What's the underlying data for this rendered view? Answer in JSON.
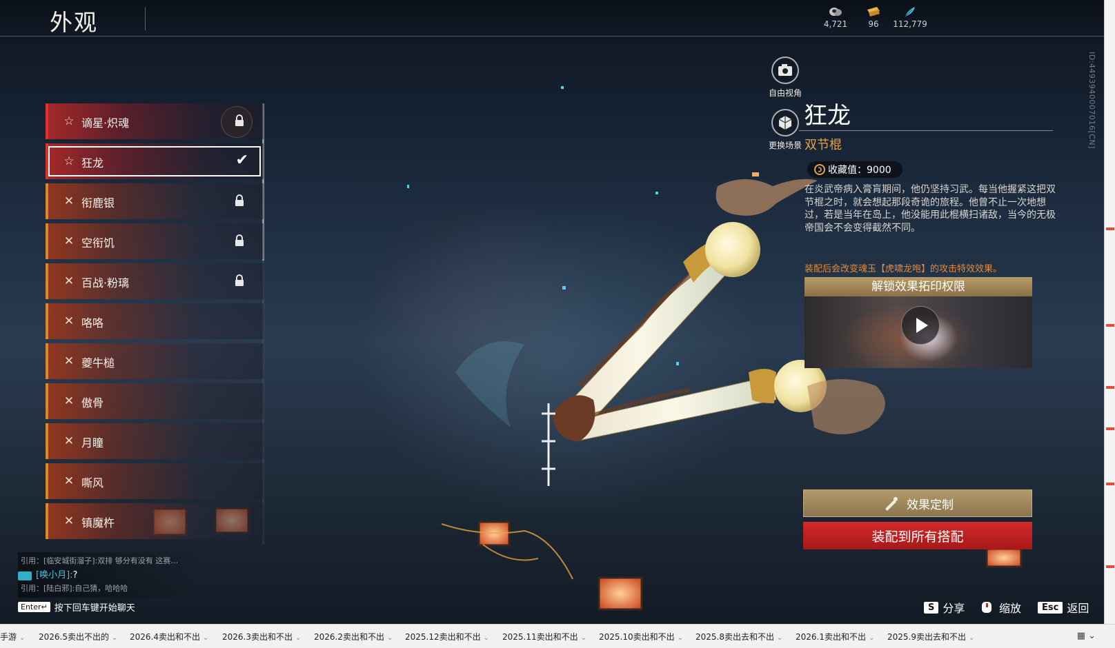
{
  "header": {
    "title": "外观",
    "currencies": [
      {
        "icon": "coin-stack-icon",
        "value": "4,721",
        "color": "#c8c8c8"
      },
      {
        "icon": "gold-ticket-icon",
        "value": "96",
        "color": "#e8b64a"
      },
      {
        "icon": "feather-icon",
        "value": "112,779",
        "color": "#3ec0d8"
      }
    ]
  },
  "side_id": "ID:4493940007016[CN]",
  "camera": {
    "free_view_label": "自由视角",
    "change_scene_label": "更换场景"
  },
  "items": [
    {
      "label": "谪星·炽魂",
      "icon": "star-icon",
      "rarity_color": "#e0322d",
      "locked": true,
      "selected": false
    },
    {
      "label": "狂龙",
      "icon": "star-icon",
      "rarity_color": "#e0322d",
      "locked": false,
      "selected": true
    },
    {
      "label": "衔鹿银",
      "icon": "cross-icon",
      "rarity_color": "#d9892b",
      "locked": true,
      "selected": false
    },
    {
      "label": "空衔饥",
      "icon": "cross-icon",
      "rarity_color": "#d9892b",
      "locked": true,
      "selected": false
    },
    {
      "label": "百战·粉璃",
      "icon": "cross-icon",
      "rarity_color": "#d9892b",
      "locked": true,
      "selected": false
    },
    {
      "label": "咯咯",
      "icon": "cross-icon",
      "rarity_color": "#d9892b",
      "locked": false,
      "selected": false
    },
    {
      "label": "夔牛槌",
      "icon": "cross-icon",
      "rarity_color": "#d9892b",
      "locked": false,
      "selected": false
    },
    {
      "label": "傲骨",
      "icon": "cross-icon",
      "rarity_color": "#d9892b",
      "locked": false,
      "selected": false
    },
    {
      "label": "月瞳",
      "icon": "cross-icon",
      "rarity_color": "#d9892b",
      "locked": false,
      "selected": false
    },
    {
      "label": "嘶风",
      "icon": "cross-icon",
      "rarity_color": "#d9892b",
      "locked": false,
      "selected": false
    },
    {
      "label": "镇魔杵",
      "icon": "cross-icon",
      "rarity_color": "#d9892b",
      "locked": false,
      "selected": false
    }
  ],
  "details": {
    "name": "狂龙",
    "type": "双节棍",
    "collection_label": "收藏值：9000",
    "description": "在炎武帝病入膏肓期间，他仍坚持习武。每当他握紧这把双节棍之时，就会想起那段奇诡的旅程。他曾不止一次地想过，若是当年在岛上，他没能用此棍横扫诸敌，当今的无极帝国会不会变得截然不同。",
    "equip_note": "装配后会改变魂玉【虎啸龙咆】的攻击特效效果。",
    "unlock_header": "解锁效果拓印权限",
    "customize_label": "效果定制",
    "equip_all_label": "装配到所有搭配"
  },
  "chat": {
    "line1": "引用：[临安城街溜子]:双排 够分有没有 这赛…",
    "line2_name": "[唤小月]:",
    "line2_text": "?",
    "line3": "引用：[陆白邪]:自己猜，哈哈哈",
    "enter_key": "Enter↵",
    "enter_hint": "按下回车键开始聊天"
  },
  "hints": {
    "share_key": "S",
    "share_label": "分享",
    "zoom_label": "缩放",
    "back_key": "Esc",
    "back_label": "返回"
  },
  "taskbar": {
    "items": [
      "手游",
      "2026.5卖出不出的",
      "2026.4卖出和不出",
      "2026.3卖出和不出",
      "2026.2卖出和不出",
      "2025.12卖出和不出",
      "2025.11卖出和不出",
      "2025.10卖出和不出",
      "2025.8卖出去和不出",
      "2026.1卖出和不出",
      "2025.9卖出去和不出"
    ],
    "end_icon": "grid-icon"
  }
}
